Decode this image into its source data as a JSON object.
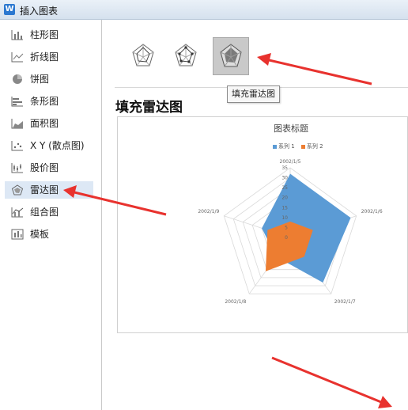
{
  "window": {
    "title": "插入图表",
    "app_icon_letter": "W"
  },
  "sidebar": {
    "items": [
      {
        "label": "柱形图",
        "icon": "column-chart-icon"
      },
      {
        "label": "折线图",
        "icon": "line-chart-icon"
      },
      {
        "label": "饼图",
        "icon": "pie-chart-icon"
      },
      {
        "label": "条形图",
        "icon": "bar-chart-icon"
      },
      {
        "label": "面积图",
        "icon": "area-chart-icon"
      },
      {
        "label": "X Y (散点图)",
        "icon": "scatter-chart-icon"
      },
      {
        "label": "股价图",
        "icon": "stock-chart-icon"
      },
      {
        "label": "雷达图",
        "icon": "radar-chart-icon",
        "active": true
      },
      {
        "label": "组合图",
        "icon": "combo-chart-icon"
      },
      {
        "label": "模板",
        "icon": "template-icon"
      }
    ]
  },
  "subtypes": [
    {
      "icon": "radar-icon",
      "selected": false
    },
    {
      "icon": "radar-markers-icon",
      "selected": false
    },
    {
      "icon": "filled-radar-icon",
      "selected": true
    }
  ],
  "tooltip": "填充雷达图",
  "section_title": "填充雷达图",
  "chart_data": {
    "type": "radar",
    "title": "图表标题",
    "categories": [
      "2002/1/5",
      "2002/1/6",
      "2002/1/7",
      "2002/1/8",
      "2002/1/9"
    ],
    "ticks": [
      "0",
      "5",
      "10",
      "15",
      "20",
      "25",
      "30",
      "35"
    ],
    "rlim": [
      0,
      35
    ],
    "legend": "top",
    "series": [
      {
        "name": "系列 1",
        "values": [
          32,
          32,
          28,
          12,
          15
        ],
        "color": "#5b9bd5"
      },
      {
        "name": "系列 2",
        "values": [
          8,
          12,
          12,
          21,
          12
        ],
        "color": "#ed7d31"
      }
    ]
  },
  "colors": {
    "arrow": "#e8322e",
    "active_bg": "#dde8f5"
  }
}
